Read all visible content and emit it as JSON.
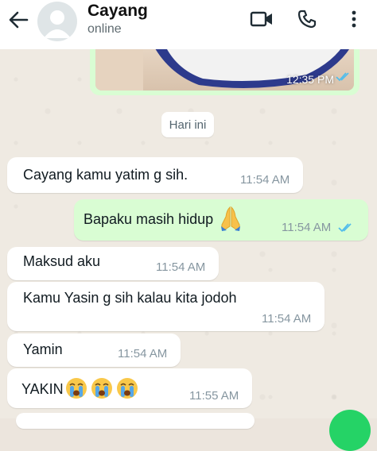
{
  "header": {
    "contact_name": "Cayang",
    "status": "online",
    "icons": [
      "back-arrow-icon",
      "video-call-icon",
      "voice-call-icon",
      "more-options-icon"
    ]
  },
  "shared_image": {
    "time": "12:35 PM",
    "read": true
  },
  "date_chip": "Hari ini",
  "messages": [
    {
      "direction": "in",
      "text": "Cayang kamu yatim g sih.",
      "time": "11:54 AM"
    },
    {
      "direction": "out",
      "text": "Bapaku masih hidup",
      "emoji": "folded-hands-emoji",
      "time": "11:54 AM",
      "read": true
    },
    {
      "direction": "in",
      "text": "Maksud aku",
      "time": "11:54 AM"
    },
    {
      "direction": "in",
      "text": "Kamu Yasin g sih kalau kita jodoh",
      "time": "11:54 AM"
    },
    {
      "direction": "in",
      "text": "Yamin",
      "time": "11:54 AM"
    },
    {
      "direction": "in",
      "text": "YAKIN",
      "emoji": "crying-face-emoji x3",
      "time": "11:55 AM"
    }
  ],
  "colors": {
    "outgoing_bubble": "#d9fdd3",
    "incoming_bubble": "#ffffff",
    "read_tick": "#53bdeb",
    "chat_background": "#efeae2"
  }
}
